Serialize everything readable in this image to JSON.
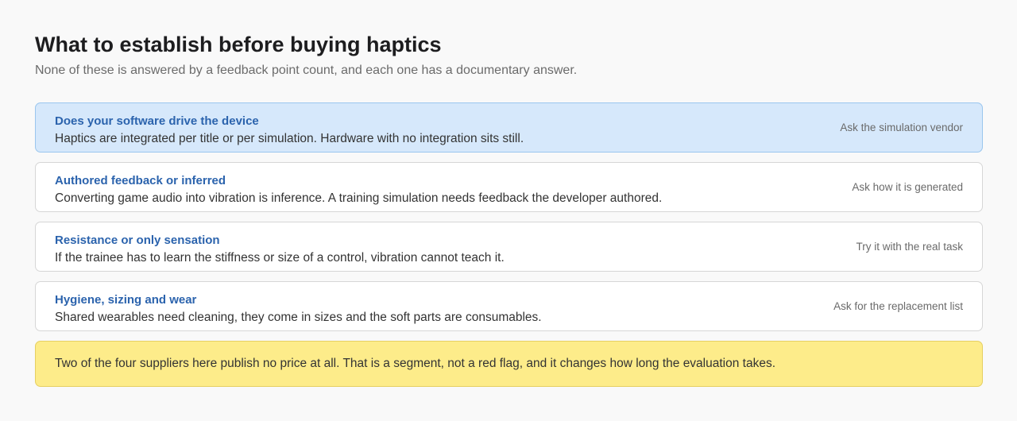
{
  "header": {
    "title": "What to establish before buying haptics",
    "subtitle": "None of these is answered by a feedback point count, and each one has a documentary answer."
  },
  "items": [
    {
      "title": "Does your software drive the device",
      "description": "Haptics are integrated per title or per simulation. Hardware with no integration sits still.",
      "action": "Ask the simulation vendor",
      "selected": true
    },
    {
      "title": "Authored feedback or inferred",
      "description": "Converting game audio into vibration is inference. A training simulation needs feedback the developer authored.",
      "action": "Ask how it is generated",
      "selected": false
    },
    {
      "title": "Resistance or only sensation",
      "description": "If the trainee has to learn the stiffness or size of a control, vibration cannot teach it.",
      "action": "Try it with the real task",
      "selected": false
    },
    {
      "title": "Hygiene, sizing and wear",
      "description": "Shared wearables need cleaning, they come in sizes and the soft parts are consumables.",
      "action": "Ask for the replacement list",
      "selected": false
    }
  ],
  "note": {
    "text": "Two of the four suppliers here publish no price at all. That is a segment, not a red flag, and it changes how long the evaluation takes."
  },
  "colors": {
    "selected_bg": "#d6e8fb",
    "title_blue": "#2b63ad",
    "note_bg": "#fdec8a"
  }
}
